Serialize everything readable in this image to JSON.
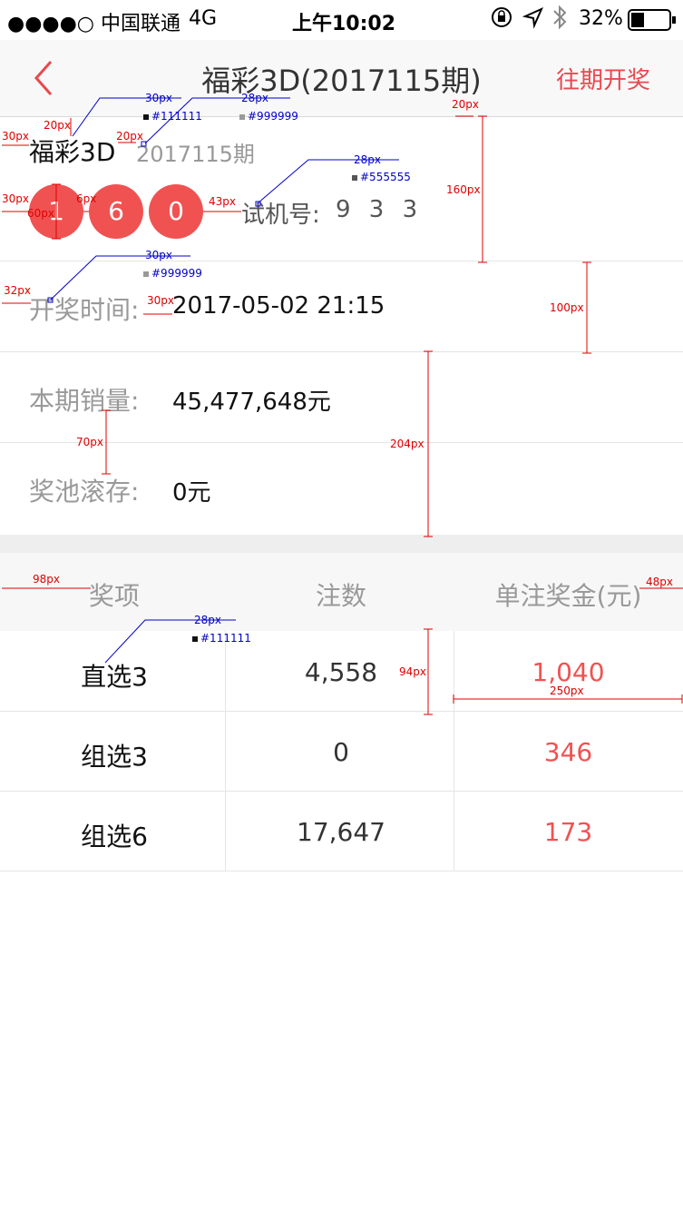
{
  "status_bar": {
    "carrier": "●●●●○ 中国联通",
    "network": "4G",
    "time": "上午10:02",
    "battery": "32%",
    "icons": [
      "lock-rotation-icon",
      "location-icon",
      "bluetooth-icon",
      "battery-icon"
    ]
  },
  "nav": {
    "title": "福彩3D(2017115期)",
    "right_link": "往期开奖",
    "accent": "#e8494e"
  },
  "draw": {
    "name": "福彩3D",
    "issue": "2017115期",
    "balls": [
      "1",
      "6",
      "0"
    ],
    "ball_color": "#f05252",
    "trial_label": "试机号:",
    "trial_number": "9 3 3"
  },
  "info": [
    {
      "label": "开奖时间:",
      "value": "2017-05-02 21:15"
    },
    {
      "label": "本期销量:",
      "value": "45,477,648元"
    },
    {
      "label": "奖池滚存:",
      "value": "0元"
    }
  ],
  "table": {
    "headers": [
      "奖项",
      "注数",
      "单注奖金(元)"
    ],
    "rows": [
      {
        "name": "直选3",
        "count": "4,558",
        "prize": "1,040"
      },
      {
        "name": "组选3",
        "count": "0",
        "prize": "346"
      },
      {
        "name": "组选6",
        "count": "17,647",
        "prize": "173"
      }
    ],
    "prize_color": "#f05252"
  },
  "annotations": {
    "red": [
      "30px",
      "20px",
      "20px",
      "20px",
      "160px",
      "30px",
      "6px",
      "60px",
      "43px",
      "32px",
      "30px",
      "100px",
      "70px",
      "204px",
      "98px",
      "48px",
      "94px",
      "250px"
    ],
    "blue": [
      {
        "size": "30px",
        "color": "#111111"
      },
      {
        "size": "28px",
        "color": "#999999"
      },
      {
        "size": "28px",
        "color": "#555555"
      },
      {
        "size": "30px",
        "color": "#999999"
      },
      {
        "size": "28px",
        "color": "#111111"
      }
    ]
  }
}
